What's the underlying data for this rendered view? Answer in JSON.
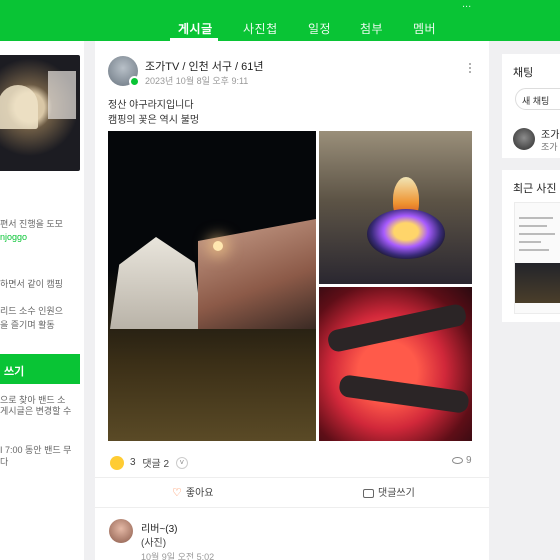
{
  "nav": {
    "tabs": [
      {
        "label": "게시글",
        "active": true
      },
      {
        "label": "사진첩"
      },
      {
        "label": "일정"
      },
      {
        "label": "첨부"
      },
      {
        "label": "멤버"
      }
    ],
    "corner_text": "..."
  },
  "left": {
    "line1": "편서 진행을 도모",
    "line2": "njoggo",
    "line3": "하면서 같이 캠핑",
    "line4": "리드 소수 인원으",
    "line5": "을 즐기며 활동",
    "write_label": "쓰기",
    "notice1": "으로 찾아 밴드 소",
    "notice2": "게시글은 변경할 수",
    "notice3": "I 7:00 동안 밴드 무",
    "notice4": "다"
  },
  "post": {
    "author": "조가TV / 인천 서구 / 61년",
    "time": "2023년 10월 8일 오후 9:11",
    "body_line1": "정산 야구라지입니다",
    "body_line2": "캠핑의 꽃은 역시 불멍",
    "reactions_count": "3",
    "comments_label": "댓글 2",
    "views": "9",
    "like_label": "좋아요",
    "comment_label": "댓글쓰기"
  },
  "comment": {
    "name": "리버~(3)",
    "text": "(사진)",
    "time": "10월 9일 오전 5:02"
  },
  "right": {
    "chat_title": "채팅",
    "new_chat": "새 채팅",
    "chat_name": "조가",
    "chat_sub": "조가",
    "recent_title": "최근 사진"
  },
  "colors": {
    "brand": "#09c435"
  }
}
